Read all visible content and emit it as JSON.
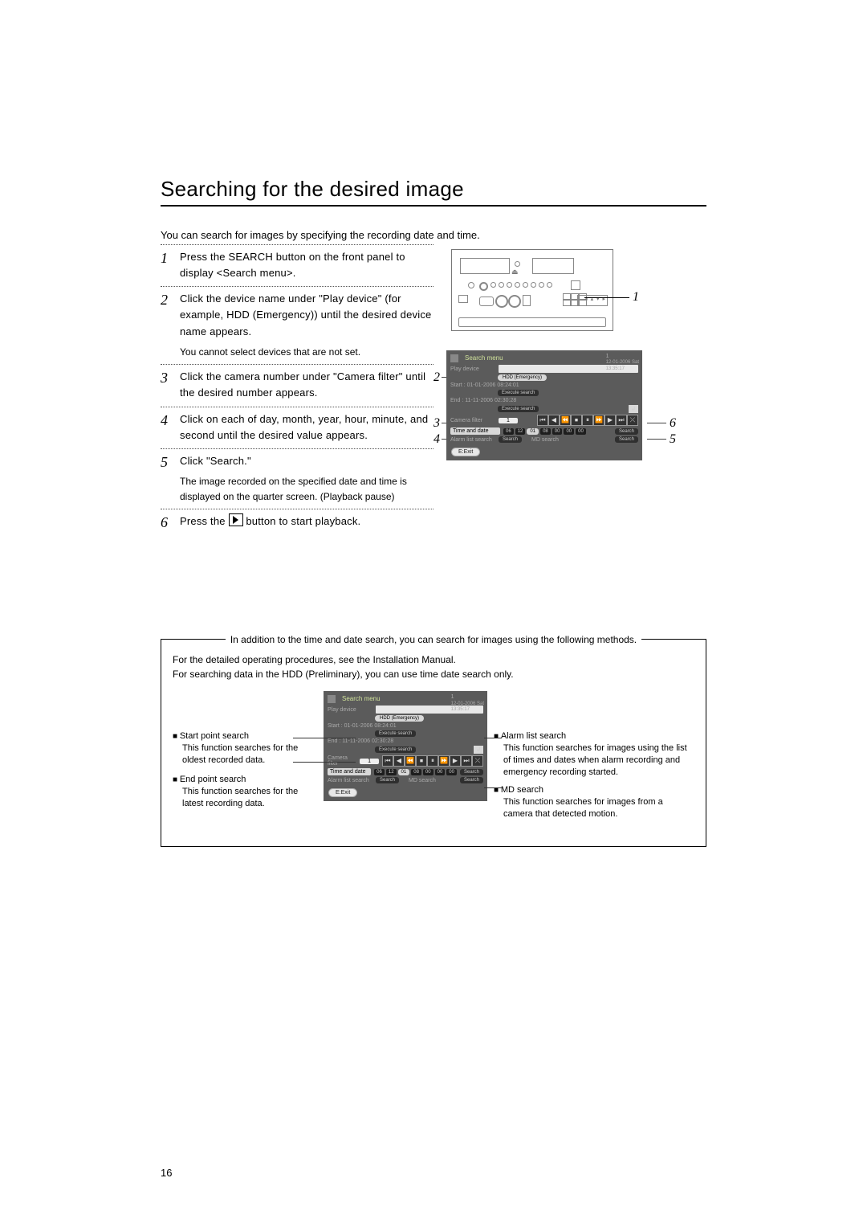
{
  "page_number": "16",
  "section_title": "Searching for the desired image",
  "intro": "You can search for images by specifying the recording date and time.",
  "steps": [
    {
      "n": "1",
      "main": "Press the SEARCH button on the front panel to display <Search menu>.",
      "sub": ""
    },
    {
      "n": "2",
      "main": "Click the device name under \"Play device\" (for example, HDD (Emergency)) until the desired device name appears.",
      "sub": "You cannot select devices that are not set."
    },
    {
      "n": "3",
      "main": "Click the camera number under \"Camera filter\" until the desired number appears.",
      "sub": ""
    },
    {
      "n": "4",
      "main": "Click on each of day, month, year, hour, minute, and second until the desired value appears.",
      "sub": ""
    },
    {
      "n": "5",
      "main": "Click \"Search.\"",
      "sub": "The image recorded on the specified date and time is displayed on the quarter screen. (Playback pause)"
    },
    {
      "n": "6",
      "main": "Press the  ▶  button to start playback.",
      "sub": ""
    }
  ],
  "step6_pre": "Press the ",
  "step6_post": " button to start playback.",
  "leads_panel": {
    "1": "1"
  },
  "leads_menu": {
    "2": "2",
    "3": "3",
    "4": "4",
    "5": "5",
    "6": "6"
  },
  "menu": {
    "title": "Search menu",
    "clock_line1": "12-01-2006 Sat",
    "clock_line2": "13:35:17",
    "clock_camera": "1",
    "play_device_label": "Play device",
    "play_device_value": "HDD (Emergency)",
    "start_label": "Start : 01-01-2006 08:24:01",
    "end_label": "End : 11-11-2006 02:30:28",
    "execute": "Execute search",
    "camera_filter_label": "Camera filter",
    "camera_filter_value": "1",
    "time_date_label": "Time and date",
    "time_date_values": [
      "06",
      "12",
      "01",
      "08",
      "00",
      "00",
      "00"
    ],
    "search_btn": "Search",
    "alarm_label": "Alarm list search",
    "md_label": "MD search",
    "exit": "E:Exit",
    "transport": [
      "⏮",
      "◀",
      "⏪",
      "⏹",
      "⏸",
      "⏩",
      "▶",
      "⏭",
      "⤫"
    ]
  },
  "info": {
    "box_title": "In addition to the time and date search, you can search for images using the following methods.",
    "line1": "For the detailed operating procedures, see the Installation Manual.",
    "line2": "For searching data in the HDD (Preliminary), you can use time date search only.",
    "left": [
      {
        "t": "Start point search",
        "d": "This function searches for the oldest recorded data."
      },
      {
        "t": "End point search",
        "d": "This function searches for the latest recording data."
      }
    ],
    "right": [
      {
        "t": "Alarm list search",
        "d": "This function searches for images using the list of times and dates when alarm recording and emergency recording started."
      },
      {
        "t": "MD search",
        "d": "This function searches for images from a camera that detected motion."
      }
    ]
  }
}
